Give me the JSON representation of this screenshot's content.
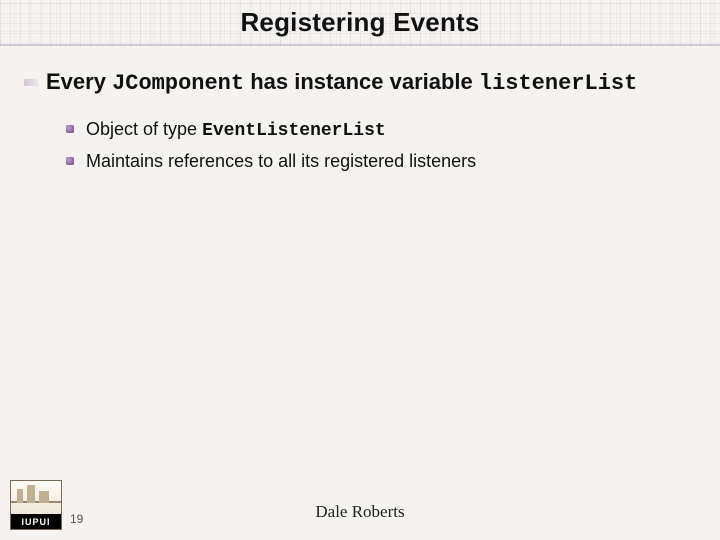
{
  "title": "Registering Events",
  "bullet1": {
    "pre": "Every ",
    "code1": "JComponent",
    "mid": " has instance variable ",
    "code2": "listenerList"
  },
  "sub1": {
    "pre": "Object of type ",
    "code": "EventListenerList"
  },
  "sub2": "Maintains references to all its registered listeners",
  "logo_text": "IUPUI",
  "slide_number": "19",
  "author": "Dale Roberts"
}
